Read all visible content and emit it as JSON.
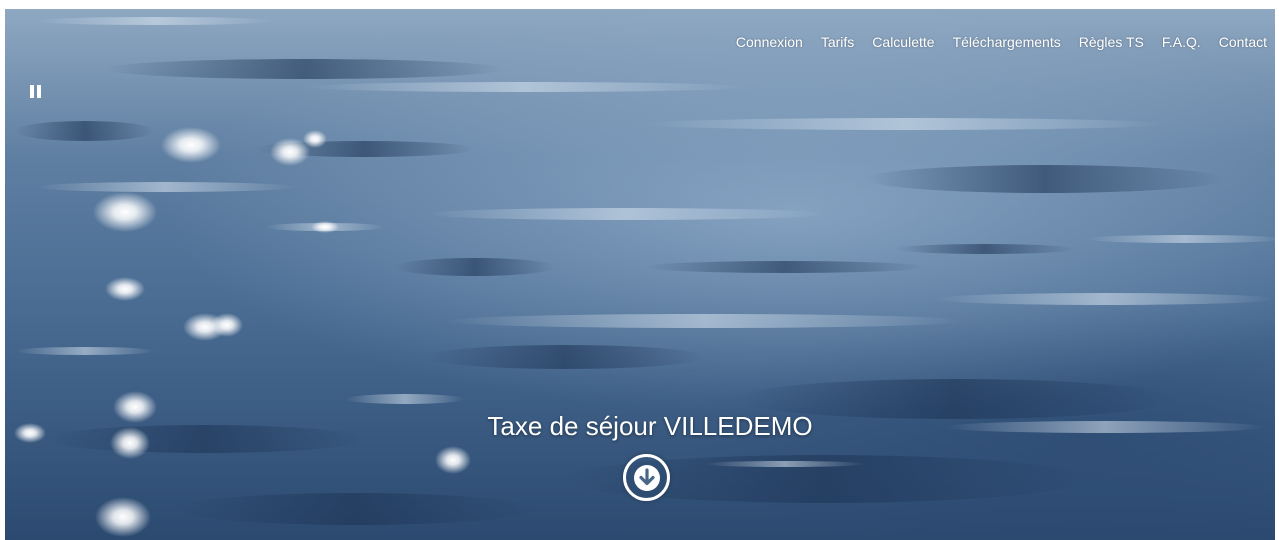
{
  "nav": {
    "items": [
      {
        "label": "Connexion"
      },
      {
        "label": "Tarifs"
      },
      {
        "label": "Calculette"
      },
      {
        "label": "Téléchargements"
      },
      {
        "label": "Règles TS"
      },
      {
        "label": "F.A.Q."
      },
      {
        "label": "Contact"
      }
    ]
  },
  "hero": {
    "title": "Taxe de séjour VILLEDEMO",
    "background": "water-surface-image",
    "pause_icon": "pause-icon",
    "scroll_icon": "arrow-down-circle-icon"
  },
  "colors": {
    "text": "#ffffff",
    "water_light": "#8fa8c2",
    "water_dark": "#2c4a70"
  }
}
